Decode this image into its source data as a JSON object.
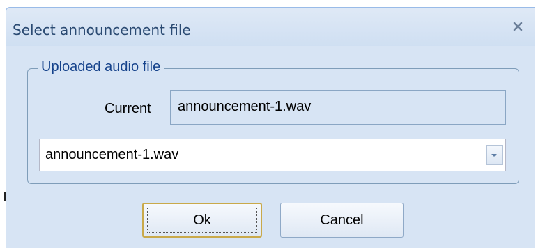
{
  "dialog": {
    "title": "Select announcement file",
    "close_icon": "close-icon"
  },
  "fieldset": {
    "legend": "Uploaded audio file",
    "current_label": "Current",
    "current_value": "announcement-1.wav"
  },
  "file_select": {
    "selected": "announcement-1.wav",
    "trigger_icon": "chevron-down-icon"
  },
  "buttons": {
    "ok_label": "Ok",
    "cancel_label": "Cancel"
  },
  "colors": {
    "dialog_background": "#d7e4f4",
    "title_text": "#2a4a72",
    "legend_text": "#15428b",
    "border": "#99bbe8",
    "focus_border": "#c9a94a"
  }
}
